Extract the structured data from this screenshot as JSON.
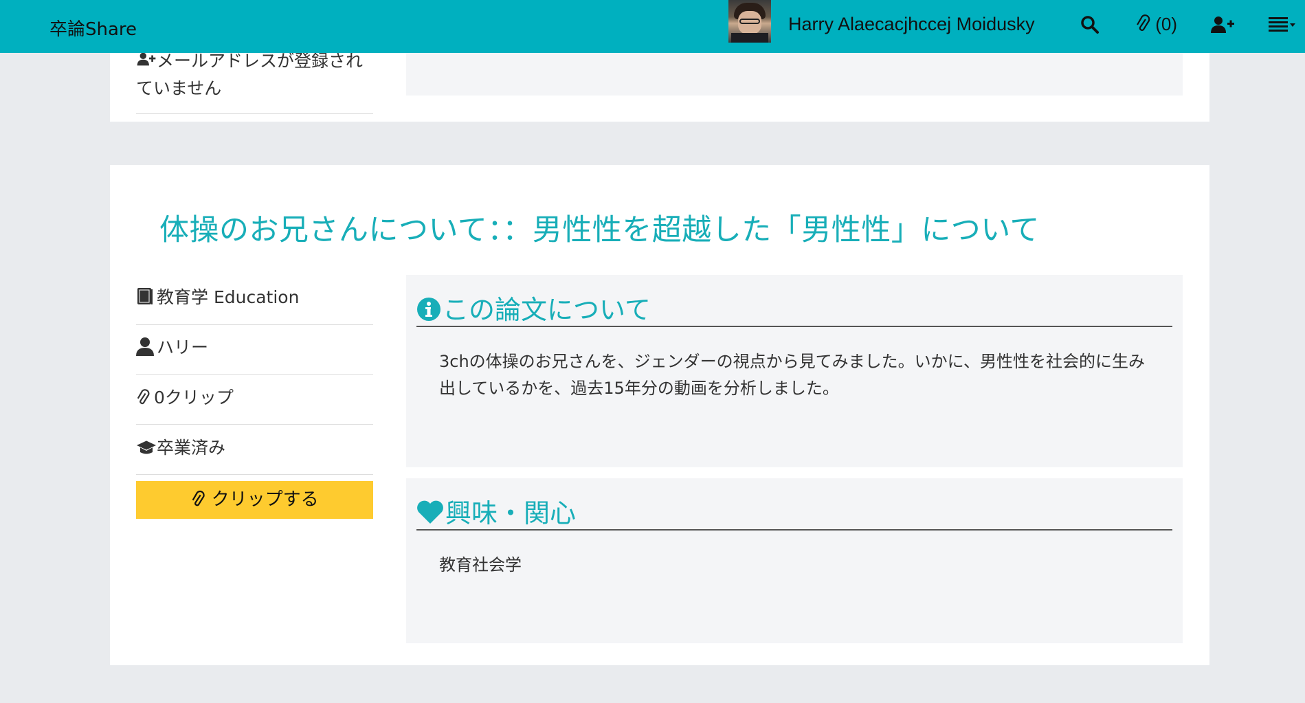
{
  "navbar": {
    "brand": "卒論Share",
    "username": "Harry Alaecacjhccej Moidusky",
    "clips": "(0)"
  },
  "top_card": {
    "email_notice_line1": "メールアドレスが登録され",
    "email_notice_line2": "ていません"
  },
  "paper": {
    "title": "体操のお兄さんについて：：男性性を超越した「男性性」について",
    "field": "教育学 Education",
    "author": "ハリー",
    "clip_count": "0クリップ",
    "status": "卒業済み",
    "clip_button": "クリップする",
    "about_heading": "この論文について",
    "about_text": "3chの体操のお兄さんを、ジェンダーの視点から見てみました。いかに、男性性を社会的に生み出しているかを、過去15年分の動画を分析しました。",
    "interest_heading": "興味・関心",
    "interest_text": "教育社会学"
  },
  "colors": {
    "navbar": "#00b0bf",
    "accent": "#18aeb8",
    "clip_button": "#fecb2f",
    "background": "#e9ebee"
  },
  "icons": {
    "search": "search-icon",
    "clip": "paperclip-icon",
    "add_user": "add-user-icon",
    "menu": "list-menu-icon",
    "book": "book-icon",
    "user": "user-icon",
    "graduation": "graduation-cap-icon",
    "info": "info-circle-icon",
    "heart": "heart-icon"
  }
}
